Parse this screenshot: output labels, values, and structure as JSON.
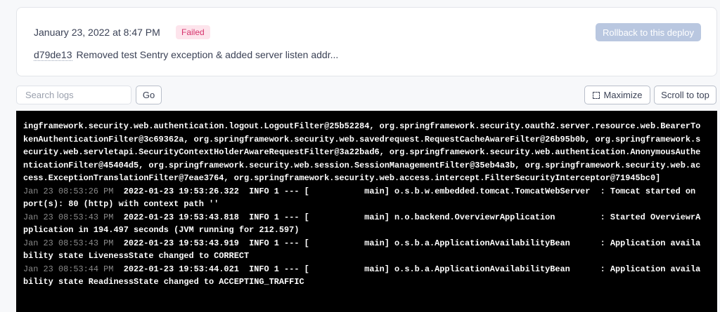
{
  "deploy": {
    "date": "January 23, 2022 at 8:47 PM",
    "status": "Failed",
    "rollback_label": "Rollback to this deploy",
    "commit_sha": "d79de13",
    "commit_message": "Removed test Sentry exception & added server listen addr..."
  },
  "toolbar": {
    "search_placeholder": "Search logs",
    "go_label": "Go",
    "maximize_label": "Maximize",
    "scroll_top_label": "Scroll to top"
  },
  "logs": [
    {
      "ts": "",
      "text": "ingframework.security.web.authentication.logout.LogoutFilter@25b52284, org.springframework.security.oauth2.server.resource.web.BearerTo"
    },
    {
      "ts": "",
      "text": "kenAuthenticationFilter@3c69362a, org.springframework.security.web.savedrequest.RequestCacheAwareFilter@26b95b0b, org.springframework.s"
    },
    {
      "ts": "",
      "text": "ecurity.web.servletapi.SecurityContextHolderAwareRequestFilter@3a22bad6, org.springframework.security.web.authentication.AnonymousAuthe"
    },
    {
      "ts": "",
      "text": "nticationFilter@45404d5, org.springframework.security.web.session.SessionManagementFilter@35eb4a3b, org.springframework.security.web.ac"
    },
    {
      "ts": "",
      "text": "cess.ExceptionTranslationFilter@7eae3764, org.springframework.security.web.access.intercept.FilterSecurityInterceptor@71945bc0]"
    },
    {
      "ts": "Jan 23 08:53:26 PM",
      "text": "  2022-01-23 19:53:26.322  INFO 1 --- [           main] o.s.b.w.embedded.tomcat.TomcatWebServer  : Tomcat started on"
    },
    {
      "ts": "",
      "text": "port(s): 80 (http) with context path ''"
    },
    {
      "ts": "Jan 23 08:53:43 PM",
      "text": "  2022-01-23 19:53:43.818  INFO 1 --- [           main] n.o.backend.OverviewrApplication         : Started OverviewrA"
    },
    {
      "ts": "",
      "text": "pplication in 194.497 seconds (JVM running for 212.597)"
    },
    {
      "ts": "Jan 23 08:53:43 PM",
      "text": "  2022-01-23 19:53:43.919  INFO 1 --- [           main] o.s.b.a.ApplicationAvailabilityBean      : Application availa"
    },
    {
      "ts": "",
      "text": "bility state LivenessState changed to CORRECT"
    },
    {
      "ts": "Jan 23 08:53:44 PM",
      "text": "  2022-01-23 19:53:44.021  INFO 1 --- [           main] o.s.b.a.ApplicationAvailabilityBean      : Application availa"
    },
    {
      "ts": "",
      "text": "bility state ReadinessState changed to ACCEPTING_TRAFFIC"
    }
  ]
}
